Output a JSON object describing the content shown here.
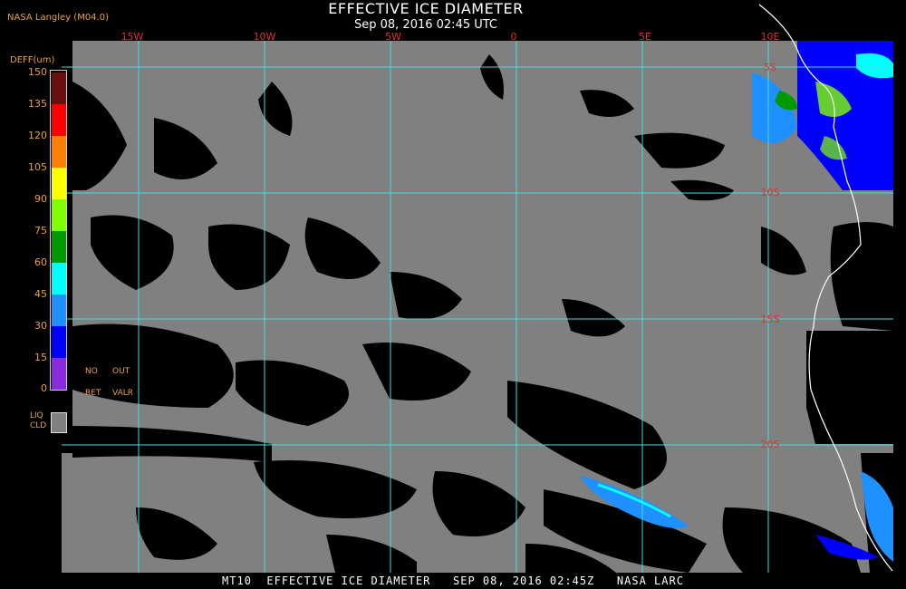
{
  "header": {
    "title": "EFFECTIVE ICE DIAMETER",
    "subtitle": "Sep 08, 2016 02:45 UTC",
    "credit": "NASA Langley (M04.0)"
  },
  "legend": {
    "title": "DEFF(um)",
    "ticks": [
      "150",
      "135",
      "120",
      "105",
      "90",
      "75",
      "60",
      "45",
      "30",
      "15",
      "0"
    ],
    "colors": [
      "#6a0f0f",
      "#ff0000",
      "#ff8000",
      "#ffff00",
      "#80ff00",
      "#009900",
      "#00ffff",
      "#1e90ff",
      "#0000ff",
      "#8a2be2"
    ],
    "flags": {
      "no": "NO",
      "out": "OUT",
      "ret": "RET",
      "valr": "VALR"
    },
    "liquid": {
      "line1": "LIQ",
      "line2": "CLD",
      "color": "#808080"
    }
  },
  "map": {
    "lon_labels": [
      "15W",
      "10W",
      "5W",
      "0",
      "5E",
      "10E"
    ],
    "lat_labels": [
      "5S",
      "10S",
      "15S",
      "20S"
    ],
    "grid_color": "#40e0e0",
    "label_color": "#e03030",
    "cloud_gray": "#808080",
    "coastline_color": "#ffffff"
  },
  "footer": {
    "text": "MT10  EFFECTIVE ICE DIAMETER   SEP 08, 2016 02:45Z   NASA LARC"
  }
}
